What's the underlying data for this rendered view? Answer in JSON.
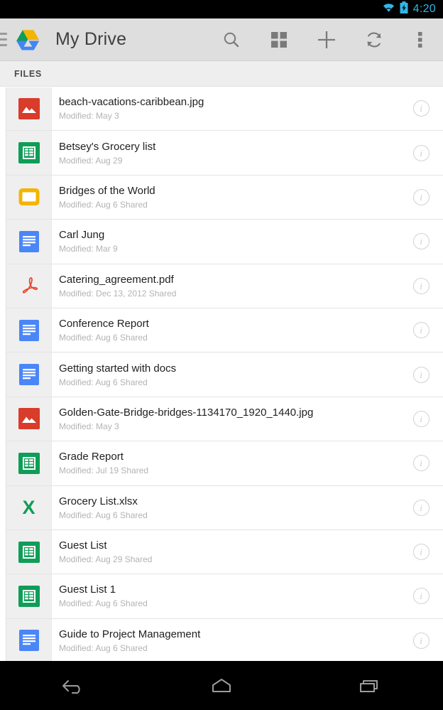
{
  "status_bar": {
    "time": "4:20",
    "wifi_icon": "wifi-icon",
    "battery_icon": "battery-charging-icon",
    "accent_color": "#33b5e5"
  },
  "action_bar": {
    "menu_icon": "hamburger-menu-icon",
    "logo_icon": "google-drive-logo",
    "title": "My Drive",
    "actions": [
      {
        "name": "search-icon",
        "label": "Search"
      },
      {
        "name": "grid-view-icon",
        "label": "Grid view"
      },
      {
        "name": "add-icon",
        "label": "New"
      },
      {
        "name": "refresh-icon",
        "label": "Refresh"
      },
      {
        "name": "overflow-menu-icon",
        "label": "More options"
      }
    ]
  },
  "tabs": [
    {
      "label": "FILES",
      "selected": true
    }
  ],
  "file_list": {
    "info_glyph": "i",
    "items": [
      {
        "title": "beach-vacations-caribbean.jpg",
        "subtitle": "Modified: May 3",
        "icon": "image-file-icon",
        "type": "image"
      },
      {
        "title": "Betsey's Grocery list",
        "subtitle": "Modified: Aug 29",
        "icon": "sheets-file-icon",
        "type": "sheet"
      },
      {
        "title": "Bridges of the World",
        "subtitle": "Modified: Aug 6  Shared",
        "icon": "slides-file-icon",
        "type": "slide"
      },
      {
        "title": "Carl Jung",
        "subtitle": "Modified: Mar 9",
        "icon": "docs-file-icon",
        "type": "doc"
      },
      {
        "title": "Catering_agreement.pdf",
        "subtitle": "Modified: Dec 13, 2012  Shared",
        "icon": "pdf-file-icon",
        "type": "pdf"
      },
      {
        "title": "Conference Report",
        "subtitle": "Modified: Aug 6  Shared",
        "icon": "docs-file-icon",
        "type": "doc"
      },
      {
        "title": "Getting started with docs",
        "subtitle": "Modified: Aug 6  Shared",
        "icon": "docs-file-icon",
        "type": "doc"
      },
      {
        "title": "Golden-Gate-Bridge-bridges-1134170_1920_1440.jpg",
        "subtitle": "Modified: May 3",
        "icon": "image-file-icon",
        "type": "image"
      },
      {
        "title": "Grade Report",
        "subtitle": "Modified: Jul 19  Shared",
        "icon": "sheets-file-icon",
        "type": "sheet"
      },
      {
        "title": "Grocery List.xlsx",
        "subtitle": "Modified: Aug 6  Shared",
        "icon": "excel-file-icon",
        "type": "xls"
      },
      {
        "title": "Guest List",
        "subtitle": "Modified: Aug 29  Shared",
        "icon": "sheets-file-icon",
        "type": "sheet"
      },
      {
        "title": "Guest List 1",
        "subtitle": "Modified: Aug 6  Shared",
        "icon": "sheets-file-icon",
        "type": "sheet"
      },
      {
        "title": "Guide to Project Management",
        "subtitle": "Modified: Aug 6  Shared",
        "icon": "docs-file-icon",
        "type": "doc"
      }
    ]
  },
  "nav_bar": {
    "buttons": [
      {
        "name": "back-button",
        "label": "Back"
      },
      {
        "name": "home-button",
        "label": "Home"
      },
      {
        "name": "recents-button",
        "label": "Recent apps"
      }
    ]
  },
  "colors": {
    "drive_green": "#0f9d58",
    "drive_yellow": "#f4b400",
    "drive_blue": "#4a86f7",
    "pdf_red": "#e8412a",
    "image_red": "#d93c2b",
    "header_bg": "#dedede",
    "gutter_bg": "#efefef"
  }
}
